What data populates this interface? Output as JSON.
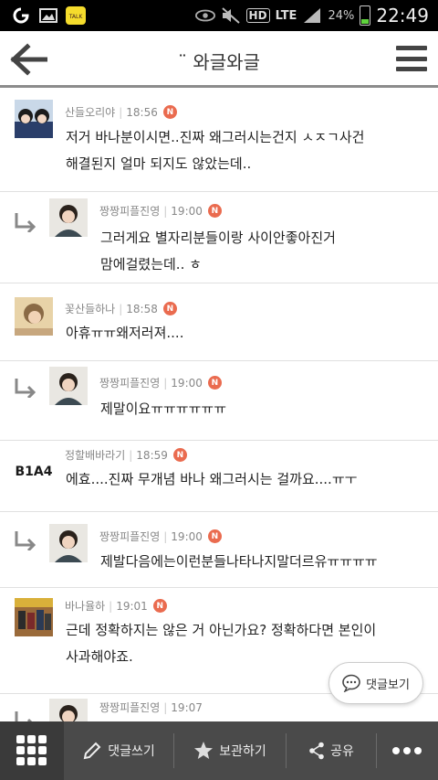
{
  "status_bar": {
    "battery_pct": "24%",
    "time": "22:49",
    "network": "LTE",
    "hd_label": "HD"
  },
  "header": {
    "title": "¨ 와글와글"
  },
  "comments": [
    {
      "type": "comment",
      "author": "산들오리야",
      "time": "18:56",
      "badge": "N",
      "lines": [
        "저거 바나분이시면..진짜 왜그러시는건지 ㅅㅈㄱ사건",
        "해결된지 얼마 되지도 않았는데.."
      ]
    },
    {
      "type": "reply",
      "author": "짱짱피플진영",
      "time": "19:00",
      "badge": "N",
      "lines": [
        "그러게요 별자리분들이랑 사이안좋아진거",
        "맘에걸렸는데.. ㅎ"
      ]
    },
    {
      "type": "comment",
      "author": "꽃산들하나",
      "time": "18:58",
      "badge": "N",
      "lines": [
        "아휴ㅠㅠ왜저러져...."
      ]
    },
    {
      "type": "reply",
      "author": "짱짱피플진영",
      "time": "19:00",
      "badge": "N",
      "lines": [
        "제말이요ㅠㅠㅠㅠㅠㅠ"
      ]
    },
    {
      "type": "comment",
      "author": "정할배바라기",
      "time": "18:59",
      "badge": "N",
      "lines": [
        "에효....진짜 무개념 바나 왜그러시는 걸까요....ㅠㅜ"
      ]
    },
    {
      "type": "reply",
      "author": "짱짱피플진영",
      "time": "19:00",
      "badge": "N",
      "lines": [
        "제발다음에는이런분들나타나지말더르유ㅠㅠㅠㅠ"
      ]
    },
    {
      "type": "comment",
      "author": "바나율하",
      "time": "19:01",
      "badge": "N",
      "lines": [
        "근데 정확하지는 않은 거 아닌가요? 정확하다면 본인이",
        "사과해야죠."
      ]
    },
    {
      "type": "reply",
      "author": "짱짱피플진영",
      "time": "19:07",
      "badge": "",
      "lines": []
    }
  ],
  "avatar_logo_text": "B1A4",
  "float_button": {
    "label": "댓글보기"
  },
  "bottom_bar": {
    "write_label": "댓글쓰기",
    "bookmark_label": "보관하기",
    "share_label": "공유"
  },
  "colors": {
    "badge": "#ea6b4f",
    "bottom_bar": "#4a4a4a",
    "reply_arrow": "#888888"
  }
}
